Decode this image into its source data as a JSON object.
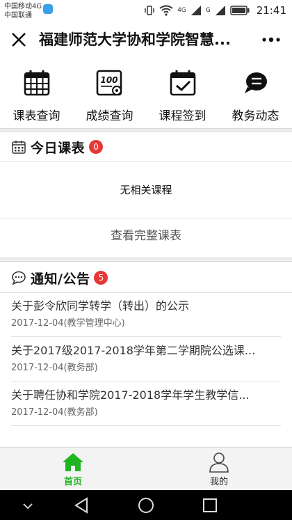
{
  "status": {
    "carrier_line1": "中国移动4G",
    "carrier_line2": "中国联通",
    "net1": "4G",
    "net2": "G",
    "time": "21:41"
  },
  "header": {
    "title": "福建师范大学协和学院智慧...",
    "close_icon": "close-icon",
    "more_icon": "more-icon"
  },
  "quick_menu": [
    {
      "label": "课表查询",
      "icon": "calendar-grid-icon"
    },
    {
      "label": "成绩查询",
      "icon": "score-gear-icon"
    },
    {
      "label": "课程签到",
      "icon": "calendar-check-icon"
    },
    {
      "label": "教务动态",
      "icon": "chat-bubble-icon"
    }
  ],
  "today_schedule": {
    "title": "今日课表",
    "badge": "0",
    "empty_text": "无相关课程",
    "view_all": "查看完整课表"
  },
  "notices": {
    "title": "通知/公告",
    "badge": "5",
    "items": [
      {
        "title": "关于彭令欣同学转学（转出）的公示",
        "meta": "2017-12-04(教学管理中心)"
      },
      {
        "title": "关于2017级2017-2018学年第二学期院公选课...",
        "meta": "2017-12-04(教务部)"
      },
      {
        "title": "关于聘任协和学院2017-2018学年学生教学信...",
        "meta": "2017-12-04(教务部)"
      }
    ]
  },
  "tabbar": {
    "home_label": "首页",
    "mine_label": "我的"
  },
  "colors": {
    "accent_green": "#20b520",
    "badge_red": "#e53935"
  }
}
